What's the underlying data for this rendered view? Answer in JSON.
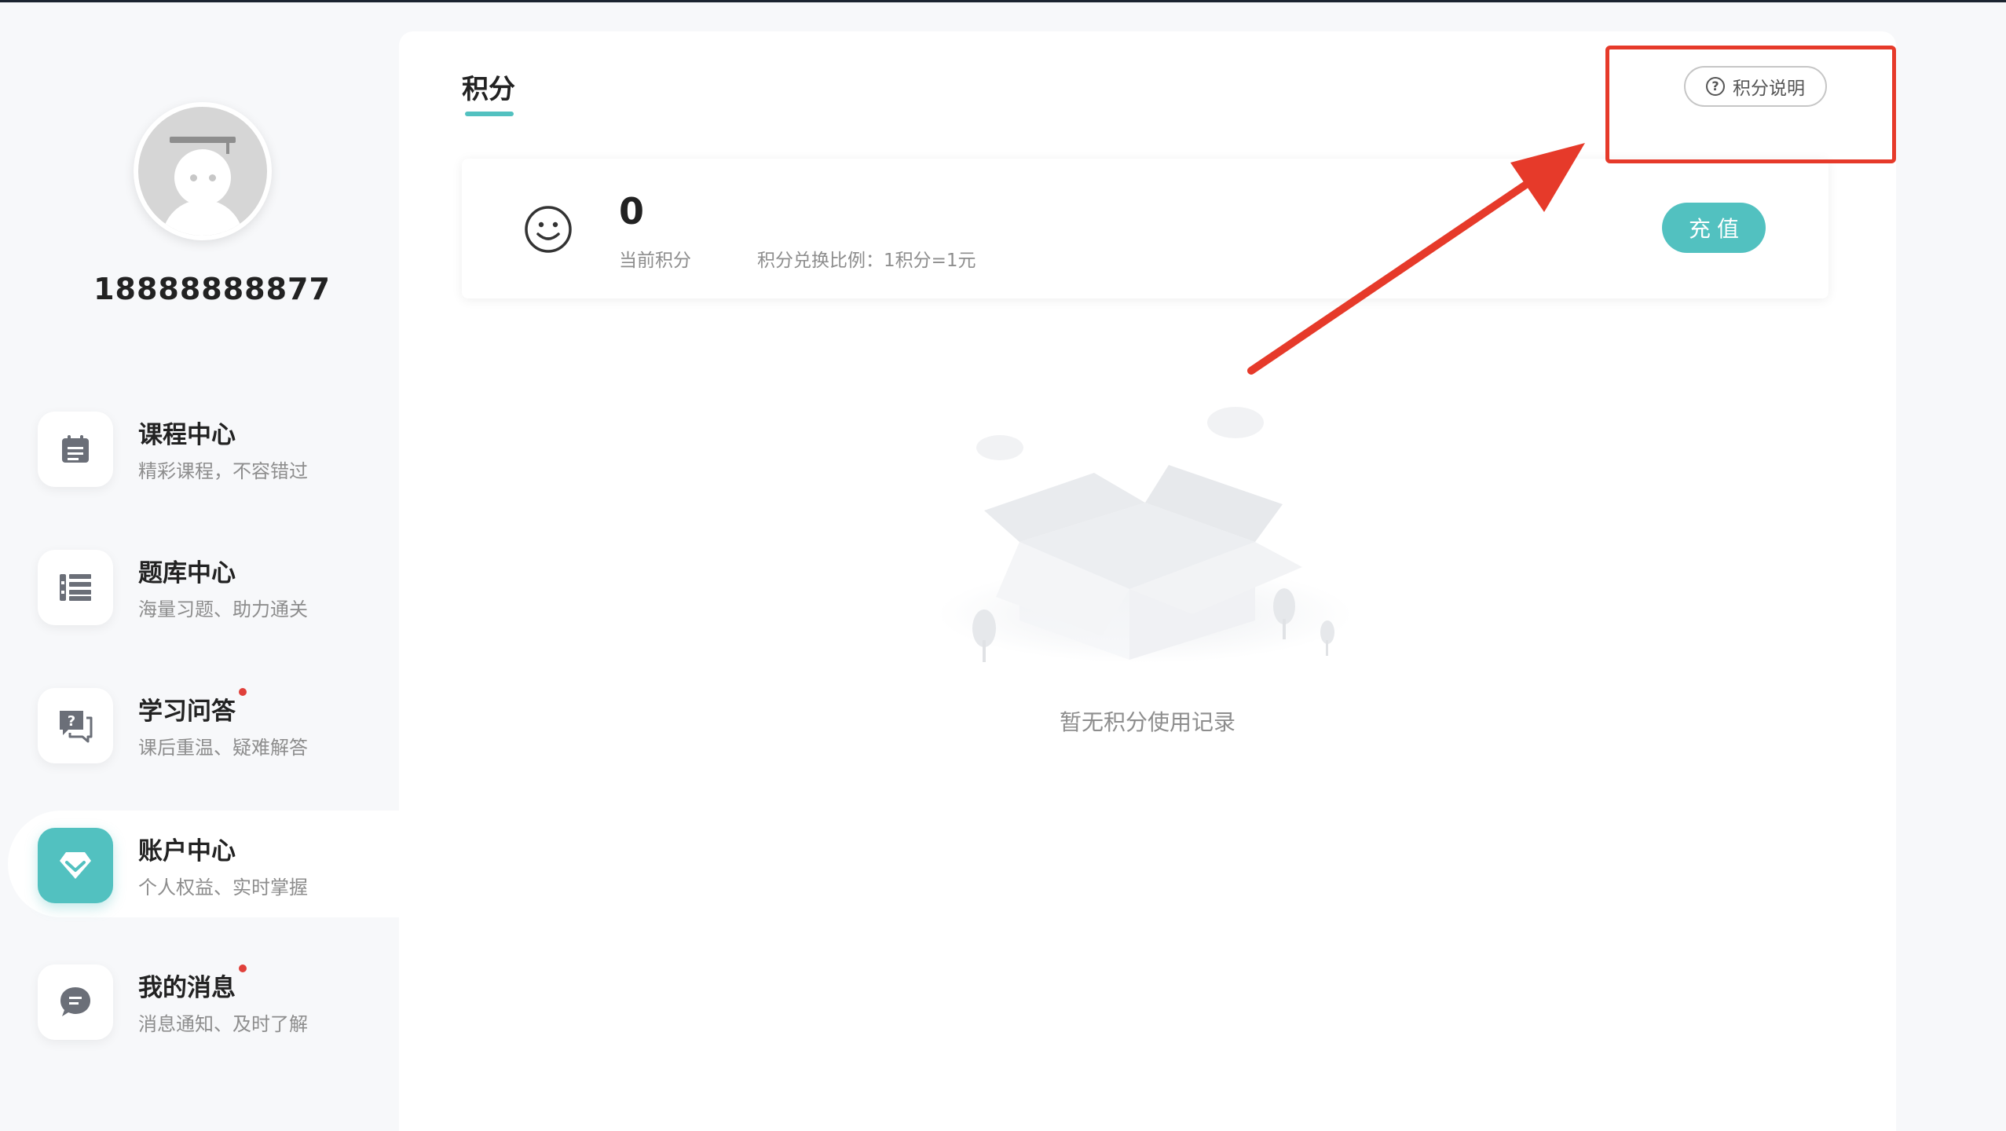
{
  "user": {
    "phone": "18888888877"
  },
  "sidebar": {
    "items": [
      {
        "title": "课程中心",
        "subtitle": "精彩课程，不容错过",
        "icon": "calendar-icon",
        "badge": false,
        "active": false
      },
      {
        "title": "题库中心",
        "subtitle": "海量习题、助力通关",
        "icon": "list-icon",
        "badge": false,
        "active": false
      },
      {
        "title": "学习问答",
        "subtitle": "课后重温、疑难解答",
        "icon": "question-chat-icon",
        "badge": true,
        "active": false
      },
      {
        "title": "账户中心",
        "subtitle": "个人权益、实时掌握",
        "icon": "diamond-icon",
        "badge": false,
        "active": true
      },
      {
        "title": "我的消息",
        "subtitle": "消息通知、及时了解",
        "icon": "message-icon",
        "badge": true,
        "active": false
      }
    ]
  },
  "main": {
    "tab_title": "积分",
    "explain_button": "积分说明",
    "points": {
      "value": "0",
      "label": "当前积分",
      "ratio_text": "积分兑换比例：1积分=1元",
      "recharge_button": "充值"
    },
    "empty_text": "暂无积分使用记录"
  },
  "colors": {
    "accent": "#52c1c0",
    "annotation": "#e63a2a",
    "badge": "#e0403a"
  }
}
